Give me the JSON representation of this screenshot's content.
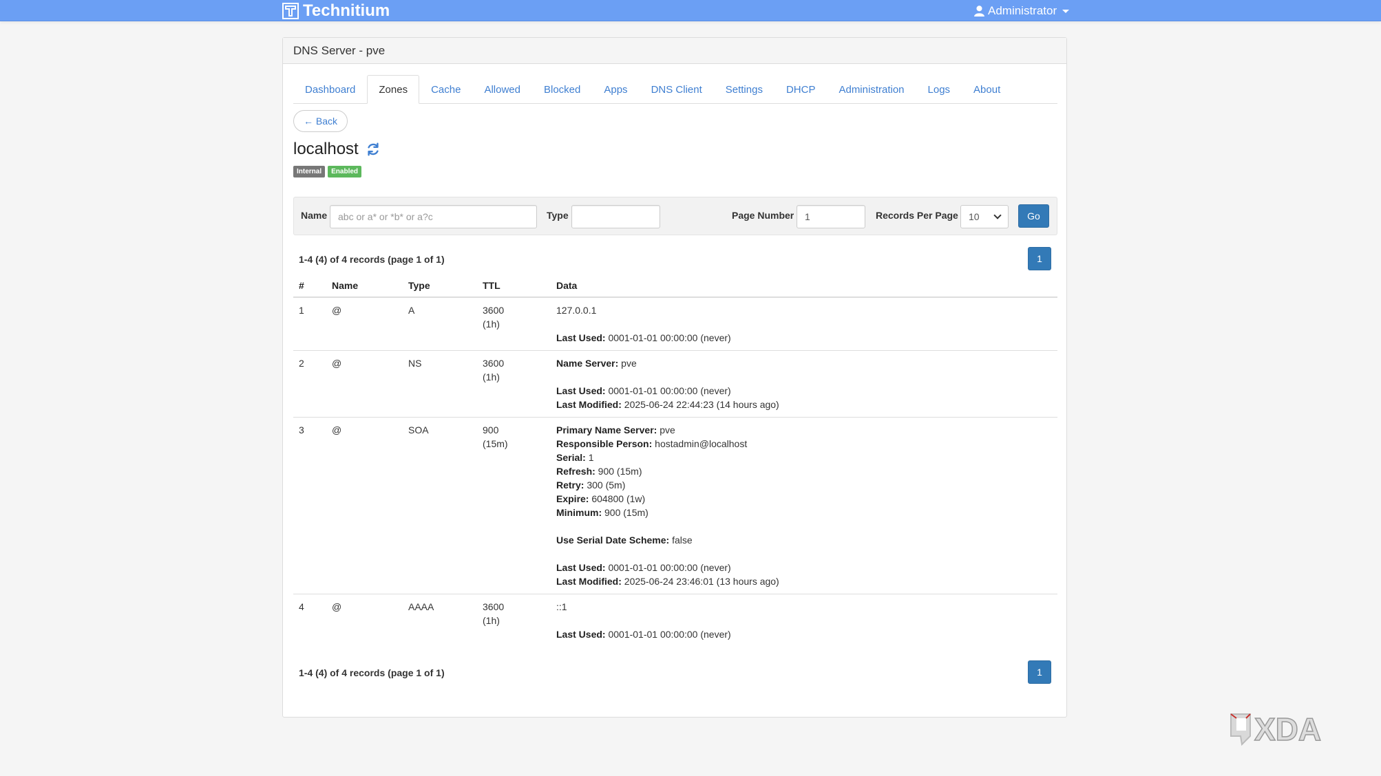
{
  "navbar": {
    "brand": "Technitium",
    "user": "Administrator"
  },
  "panel": {
    "title": "DNS Server - pve"
  },
  "tabs": [
    {
      "label": "Dashboard"
    },
    {
      "label": "Zones"
    },
    {
      "label": "Cache"
    },
    {
      "label": "Allowed"
    },
    {
      "label": "Blocked"
    },
    {
      "label": "Apps"
    },
    {
      "label": "DNS Client"
    },
    {
      "label": "Settings"
    },
    {
      "label": "DHCP"
    },
    {
      "label": "Administration"
    },
    {
      "label": "Logs"
    },
    {
      "label": "About"
    }
  ],
  "active_tab": "Zones",
  "back_label": "← Back",
  "zone": {
    "name": "localhost",
    "badge_internal": "Internal",
    "badge_enabled": "Enabled"
  },
  "filter": {
    "name_label": "Name",
    "name_placeholder": "abc or a* or *b* or a?c",
    "name_value": "",
    "type_label": "Type",
    "type_value": "",
    "page_number_label": "Page Number",
    "page_number_value": "1",
    "records_per_page_label": "Records Per Page",
    "records_per_page_value": "10",
    "go_label": "Go"
  },
  "summary_text": "1-4 (4) of 4 records (page 1 of 1)",
  "page_button": "1",
  "table": {
    "headers": [
      "#",
      "Name",
      "Type",
      "TTL",
      "Data"
    ],
    "rows": [
      {
        "num": "1",
        "name": "@",
        "type": "A",
        "ttl": "3600",
        "ttl_human": "(1h)",
        "data": [
          {
            "label": "",
            "value": "127.0.0.1"
          },
          {
            "spacer": true
          },
          {
            "label": "Last Used:",
            "value": " 0001-01-01 00:00:00 (never)"
          }
        ]
      },
      {
        "num": "2",
        "name": "@",
        "type": "NS",
        "ttl": "3600",
        "ttl_human": "(1h)",
        "data": [
          {
            "label": "Name Server:",
            "value": " pve"
          },
          {
            "spacer": true
          },
          {
            "label": "Last Used:",
            "value": " 0001-01-01 00:00:00 (never)"
          },
          {
            "label": "Last Modified:",
            "value": " 2025-06-24 22:44:23 (14 hours ago)"
          }
        ]
      },
      {
        "num": "3",
        "name": "@",
        "type": "SOA",
        "ttl": "900",
        "ttl_human": "(15m)",
        "data": [
          {
            "label": "Primary Name Server:",
            "value": " pve"
          },
          {
            "label": "Responsible Person:",
            "value": " hostadmin@localhost"
          },
          {
            "label": "Serial:",
            "value": " 1"
          },
          {
            "label": "Refresh:",
            "value": " 900 (15m)"
          },
          {
            "label": "Retry:",
            "value": " 300 (5m)"
          },
          {
            "label": "Expire:",
            "value": " 604800 (1w)"
          },
          {
            "label": "Minimum:",
            "value": " 900 (15m)"
          },
          {
            "spacer": true
          },
          {
            "label": "Use Serial Date Scheme:",
            "value": " false"
          },
          {
            "spacer": true
          },
          {
            "label": "Last Used:",
            "value": " 0001-01-01 00:00:00 (never)"
          },
          {
            "label": "Last Modified:",
            "value": " 2025-06-24 23:46:01 (13 hours ago)"
          }
        ]
      },
      {
        "num": "4",
        "name": "@",
        "type": "AAAA",
        "ttl": "3600",
        "ttl_human": "(1h)",
        "data": [
          {
            "label": "",
            "value": "::1"
          },
          {
            "spacer": true
          },
          {
            "label": "Last Used:",
            "value": " 0001-01-01 00:00:00 (never)"
          }
        ]
      }
    ]
  },
  "watermark": "XDA",
  "colors": {
    "navbar": "#6b9ff4",
    "link": "#3f7fd1",
    "primary_button": "#337ab7",
    "badge_internal": "#777777",
    "badge_enabled": "#5cb85c"
  }
}
